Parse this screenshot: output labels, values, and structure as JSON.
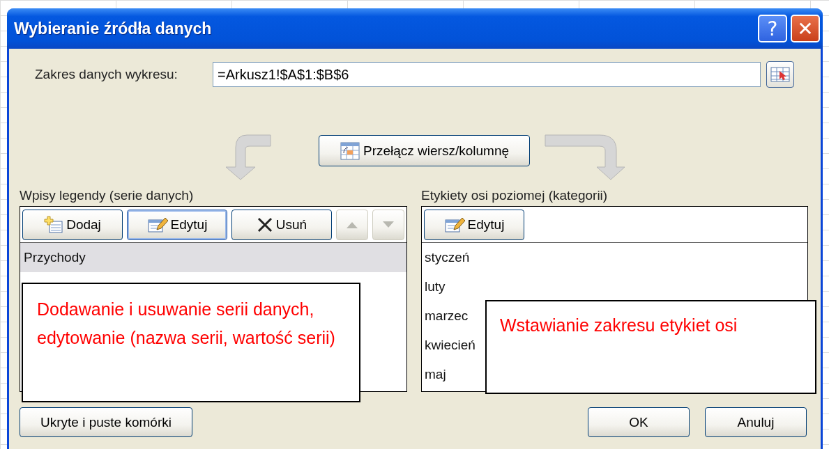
{
  "window": {
    "title": "Wybieranie źródła danych",
    "help_button": "?",
    "close_button": "✕"
  },
  "range": {
    "label": "Zakres danych wykresu:",
    "value": "=Arkusz1!$A$1:$B$6"
  },
  "switch_button": "Przełącz wiersz/kolumnę",
  "legend": {
    "label": "Wpisy legendy (serie danych)",
    "buttons": [
      {
        "label": "Dodaj",
        "kind": "add",
        "disabled": false
      },
      {
        "label": "Edytuj",
        "kind": "edit",
        "disabled": false
      },
      {
        "label": "Usuń",
        "kind": "remove",
        "disabled": false
      },
      {
        "kind": "up",
        "disabled": true
      },
      {
        "kind": "down",
        "disabled": true
      }
    ],
    "items": [
      {
        "label": "Przychody",
        "selected": true
      }
    ]
  },
  "axis": {
    "label": "Etykiety osi poziomej (kategorii)",
    "edit_button": "Edytuj",
    "items": [
      {
        "label": "styczeń",
        "selected": false
      },
      {
        "label": "luty",
        "selected": false
      },
      {
        "label": "marzec",
        "selected": false
      },
      {
        "label": "kwiecień",
        "selected": false
      },
      {
        "label": "maj",
        "selected": false
      }
    ]
  },
  "callouts": [
    {
      "text": "Dodawanie i usuwanie serii danych, edytowanie (nazwa serii, wartość serii)"
    },
    {
      "text": "Wstawianie zakresu etykiet osi"
    }
  ],
  "footer": {
    "hidden_cells_button": "Ukryte i puste komórki",
    "ok_button": "OK",
    "cancel_button": "Anuluj"
  }
}
